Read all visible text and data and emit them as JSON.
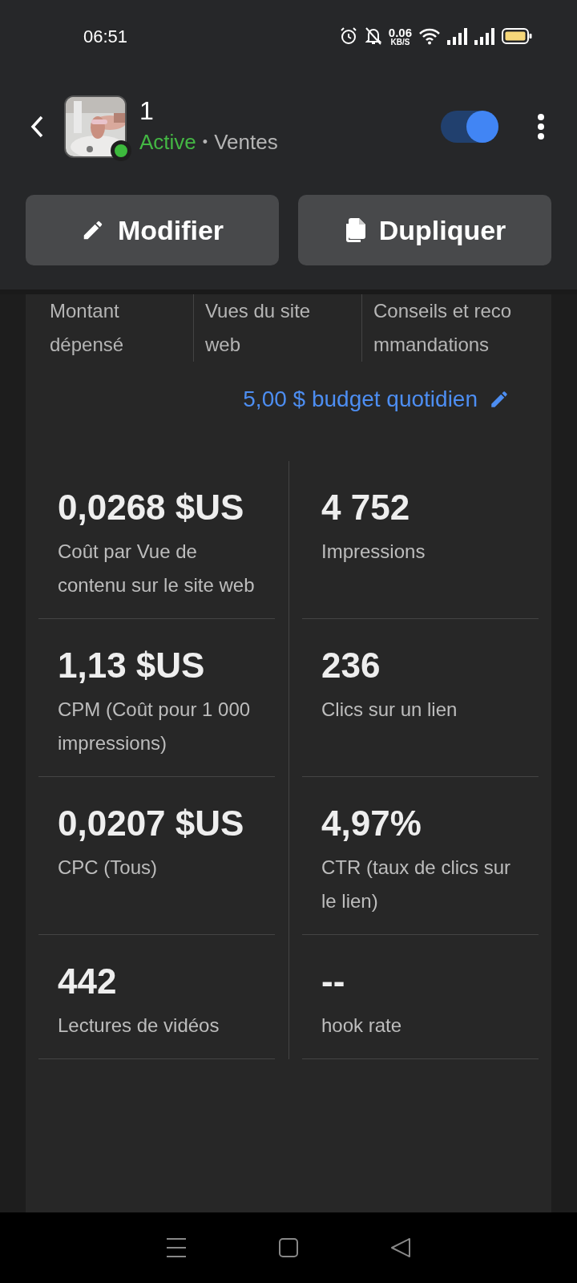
{
  "status_bar": {
    "time": "06:51",
    "speed": "0.06",
    "speed_unit": "KB/S"
  },
  "header": {
    "title": "1",
    "status": "Active",
    "separator": "•",
    "category": "Ventes",
    "enabled": true
  },
  "actions": [
    {
      "label": "Modifier",
      "kind": "edit"
    },
    {
      "label": "Dupliquer",
      "kind": "duplicate"
    }
  ],
  "tabs": [
    {
      "label": "Montant dépensé"
    },
    {
      "label": "Vues du site web"
    },
    {
      "label": "Conseils et recommandations"
    }
  ],
  "budget": "5,00 $ budget quotidien",
  "metrics": [
    {
      "value": "0,0268 $US",
      "label": "Coût par Vue de contenu sur le site web"
    },
    {
      "value": "4 752",
      "label": "Impressions"
    },
    {
      "value": "1,13 $US",
      "label": "CPM (Coût pour 1 000 impressions)"
    },
    {
      "value": "236",
      "label": "Clics sur un lien"
    },
    {
      "value": "0,0207 $US",
      "label": "CPC (Tous)"
    },
    {
      "value": "4,97%",
      "label": "CTR (taux de clics sur le lien)"
    },
    {
      "value": "442",
      "label": "Lectures de vidéos"
    },
    {
      "value": "--",
      "label": "hook rate"
    }
  ]
}
